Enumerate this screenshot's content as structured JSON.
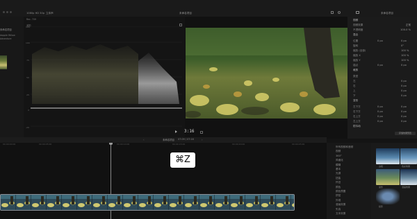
{
  "toolbar": {
    "library_label": "1080p HD 30p",
    "library_sub": "立体声",
    "center_title": "未命名项目",
    "right_title": "未命名项目"
  },
  "scope": {
    "label": "波形",
    "tick_labels": [
      "120",
      "100",
      "75",
      "50",
      "25",
      "0",
      "-20"
    ]
  },
  "viewer": {
    "timecode": "3:16",
    "size_label": "Rec. 709"
  },
  "left_panel": {
    "item_title": "未命名项目",
    "item_lines": [
      "dapple Yellow",
      "Adventure"
    ]
  },
  "inspector": {
    "header": "视频",
    "rows": [
      {
        "label": "视频效果",
        "value": "正常"
      },
      {
        "label": "不透明度",
        "value": "100.0 %"
      },
      {
        "label": "混合",
        "value": ""
      },
      {
        "label": "位置",
        "v2": "0 px",
        "v3": "0 px"
      },
      {
        "label": "旋转",
        "v2": "",
        "v3": "0°"
      },
      {
        "label": "缩放 (全部)",
        "v2": "",
        "v3": "100 %"
      },
      {
        "label": "缩放 X",
        "v2": "",
        "v3": "100 %"
      },
      {
        "label": "缩放 Y",
        "v2": "",
        "v3": "100 %"
      },
      {
        "label": "锚点",
        "v2": "0 px",
        "v3": "0 px"
      },
      {
        "label": "裁剪",
        "value": ""
      },
      {
        "label": "类型",
        "v2": "",
        "v3": ""
      },
      {
        "label": "左",
        "v2": "",
        "v3": "0 px"
      },
      {
        "label": "右",
        "v2": "",
        "v3": "0 px"
      },
      {
        "label": "上",
        "v2": "",
        "v3": "0 px"
      },
      {
        "label": "下",
        "v2": "",
        "v3": "0 px"
      },
      {
        "label": "变形",
        "value": ""
      },
      {
        "label": "左下方",
        "v2": "0 px",
        "v3": "0 px"
      },
      {
        "label": "右下方",
        "v2": "0 px",
        "v3": "0 px"
      },
      {
        "label": "右上方",
        "v2": "0 px",
        "v3": "0 px"
      },
      {
        "label": "左上方",
        "v2": "0 px",
        "v3": "0 px"
      },
      {
        "label": "防抖动",
        "value": ""
      }
    ],
    "save_button": "存储效果预置"
  },
  "timeline": {
    "title": "未命名项目",
    "duration": "07:09 / 07:16",
    "timecodes": [
      "00:00:00:00",
      "00:00:05:00",
      "00:00:10:00",
      "00:00:15:00",
      "00:00:20:00",
      "00:00:25:00"
    ]
  },
  "undo_overlay": {
    "glyph": "⌘Z"
  },
  "effects_library": {
    "items": [
      "所有视频和音频",
      "视频",
      "360°",
      "风格化",
      "模糊",
      "基本",
      "光源",
      "扭曲",
      "怀旧",
      "颜色",
      "颜色预置",
      "拼贴",
      "外观",
      "漫画效果",
      "失真",
      "文本效果"
    ]
  },
  "effect_thumbs": [
    {
      "label": "边框"
    },
    {
      "label": "色彩效果"
    },
    {
      "label": "晕影"
    },
    {
      "label": "漫画效果"
    },
    {
      "label": "投影"
    }
  ]
}
